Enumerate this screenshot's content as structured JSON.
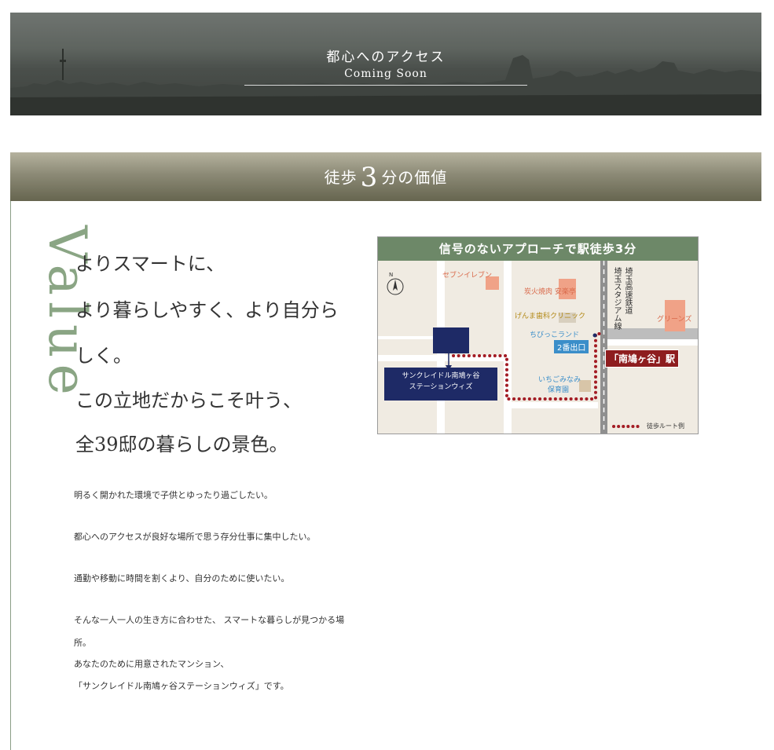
{
  "banner": {
    "title": "都心へのアクセス",
    "subtitle": "Coming Soon"
  },
  "section": {
    "pre": "徒歩",
    "number": "3",
    "post": "分の価値",
    "side_word": "Value"
  },
  "lead": [
    "よりスマートに、",
    "より暮らしやすく、より自分ら",
    "しく。",
    "この立地だからこそ叶う、",
    "全39邸の暮らしの景色。"
  ],
  "body": [
    "明るく開かれた環境で子供とゆったり過ごしたい。",
    "都心へのアクセスが良好な場所で思う存分仕事に集中したい。",
    "通勤や移動に時間を割くより、自分のために使いたい。",
    "そんな一人一人の生き方に合わせた、 スマートな暮らしが見つかる場",
    "所。",
    "あなたのために用意されたマンション、",
    "「サンクレイドル南鳩ヶ谷ステーションウィズ」です。"
  ],
  "map": {
    "title": "信号のないアプローチで駅徒歩3分",
    "north": "N",
    "seven": "セブンイレブン",
    "yakiniku": "炭火焼肉 安楽亭",
    "dental": "げんま歯科クリニック",
    "chibikko": "ちびっこランド",
    "exit": "2番出口",
    "nursery1": "いちごみなみ",
    "nursery2": "保育園",
    "greens": "グリーンズ",
    "rail_line1": "埼玉高速鉄道",
    "rail_line2": "埼玉スタジアム線",
    "station": "「南鳩ヶ谷」駅",
    "property1": "サンクレイドル南鳩ヶ谷",
    "property2": "ステーションウィズ",
    "legend": "徒歩ルート例",
    "colors": {
      "header": "#6d8868",
      "route": "#a31c24",
      "property": "#1e2a66",
      "station": "#8e1d1f",
      "poi": "#f0a287",
      "exit": "#3b8ec9"
    }
  }
}
